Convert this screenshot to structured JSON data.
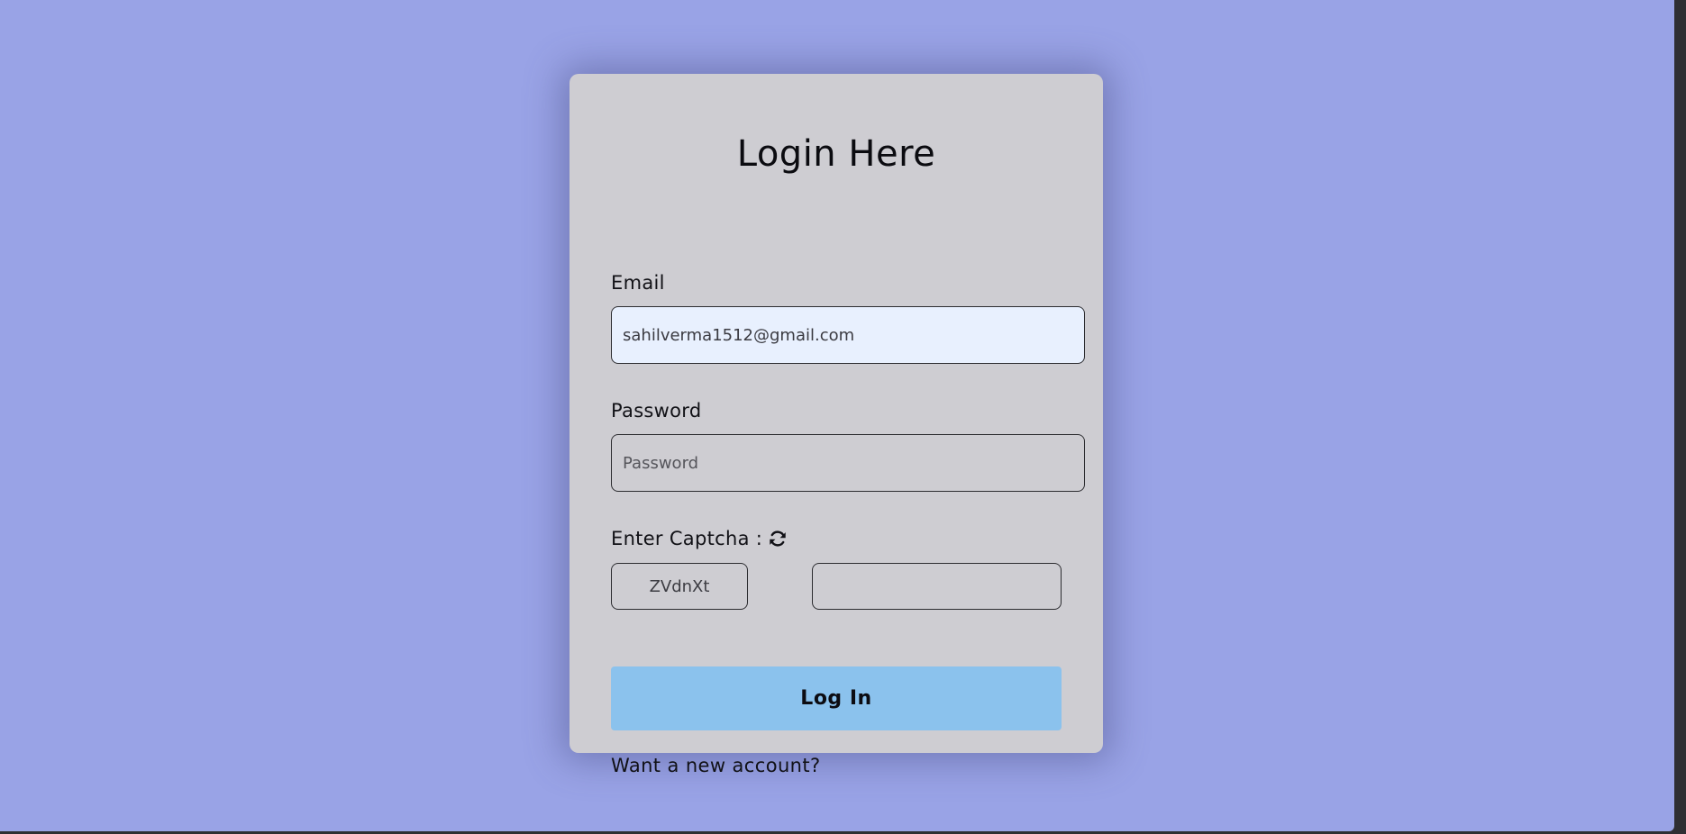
{
  "colors": {
    "background": "#99a3e6",
    "card": "#cecdd2",
    "button": "#8bc2ed",
    "email_autofill": "#e8f0fe"
  },
  "form": {
    "title": "Login Here",
    "email": {
      "label": "Email",
      "value": "sahilverma1512@gmail.com"
    },
    "password": {
      "label": "Password",
      "placeholder": "Password",
      "value": ""
    },
    "captcha": {
      "label": "Enter Captcha :",
      "icon": "refresh-icon",
      "code": "ZVdnXt",
      "input_value": ""
    },
    "login_button": "Log In",
    "new_account_link": "Want a new account?"
  }
}
